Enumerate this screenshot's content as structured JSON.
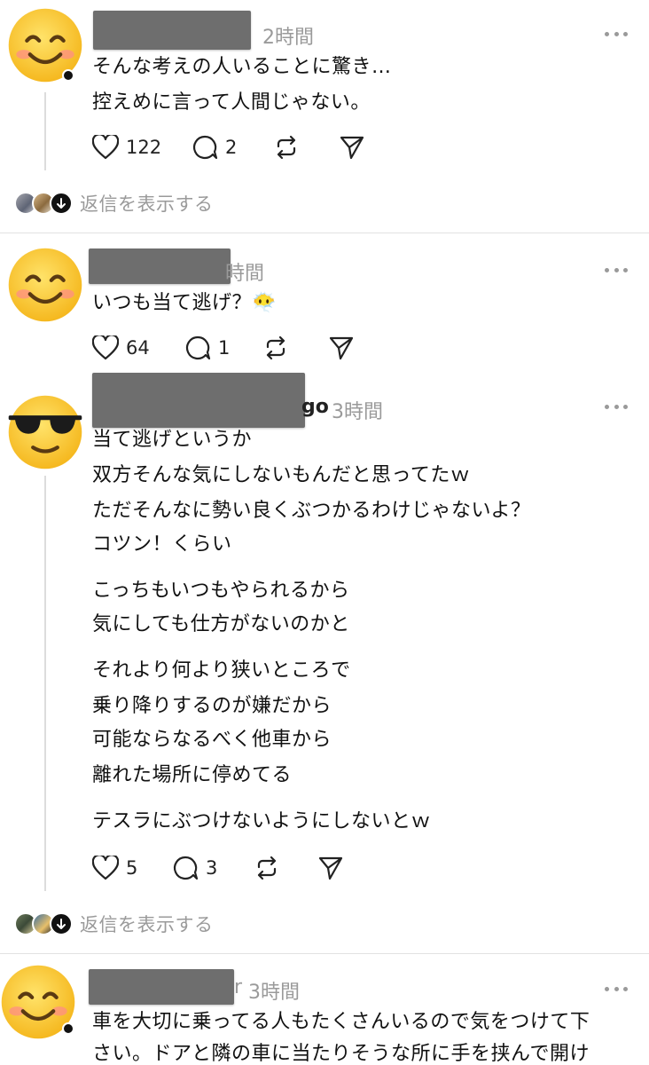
{
  "posts": [
    {
      "time": "2時間",
      "lines": [
        "そんな考えの人いることに驚き…",
        "控えめに言って人間じゃない。"
      ],
      "likes": "122",
      "comments": "2",
      "avatar_icon": "smiling-face-icon"
    },
    {
      "time": "時間",
      "lines": [
        "いつも当て逃げ？😶‍🌫️"
      ],
      "likes": "64",
      "comments": "1",
      "avatar_icon": "smiling-face-icon"
    },
    {
      "name_suffix": "go",
      "time": "3時間",
      "lines": [
        "当て逃げというか",
        "双方そんな気にしないもんだと思ってたｗ",
        "ただそんなに勢い良くぶつかるわけじゃないよ？",
        "コツン！くらい",
        "こっちもいつもやられるから",
        "気にしても仕方がないのかと",
        "それより何より狭いところで",
        "乗り降りするのが嫌だから",
        "可能ならなるべく他車から",
        "離れた場所に停めてる",
        "テスラにぶつけないようにしないとｗ"
      ],
      "likes": "5",
      "comments": "3",
      "avatar_icon": "sunglasses-face-icon"
    },
    {
      "name_suffix": "r",
      "time": "3時間",
      "lines": [
        "車を大切に乗ってる人もたくさんいるので気をつけて下",
        "さい。ドアと隣の車に当たりそうな所に手を挟んで開け"
      ],
      "avatar_icon": "smiling-face-icon"
    }
  ],
  "show_replies_label": "返信を表示する"
}
